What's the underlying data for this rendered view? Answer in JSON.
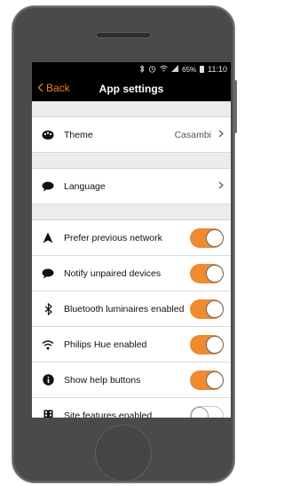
{
  "status_bar": {
    "icons": [
      "bluetooth-icon",
      "alarm-icon",
      "wifi-icon",
      "signal-icon"
    ],
    "battery": "65%",
    "time": "11:10"
  },
  "nav": {
    "back_label": "Back",
    "title": "App settings"
  },
  "settings": {
    "theme": {
      "label": "Theme",
      "value": "Casambi"
    },
    "language": {
      "label": "Language"
    },
    "toggles": [
      {
        "label": "Prefer previous network",
        "icon": "navigation-arrow-icon",
        "on": true
      },
      {
        "label": "Notify unpaired devices",
        "icon": "speech-bubble-icon",
        "on": true
      },
      {
        "label": "Bluetooth luminaires enabled",
        "icon": "bluetooth-icon",
        "on": true
      },
      {
        "label": "Philips Hue enabled",
        "icon": "wifi-icon",
        "on": true
      },
      {
        "label": "Show help buttons",
        "icon": "info-icon",
        "on": true
      },
      {
        "label": "Site features enabled",
        "icon": "building-icon",
        "on": false
      }
    ]
  },
  "colors": {
    "accent": "#f08a2e",
    "nav_background": "#000000",
    "back_text": "#f07c1e"
  }
}
